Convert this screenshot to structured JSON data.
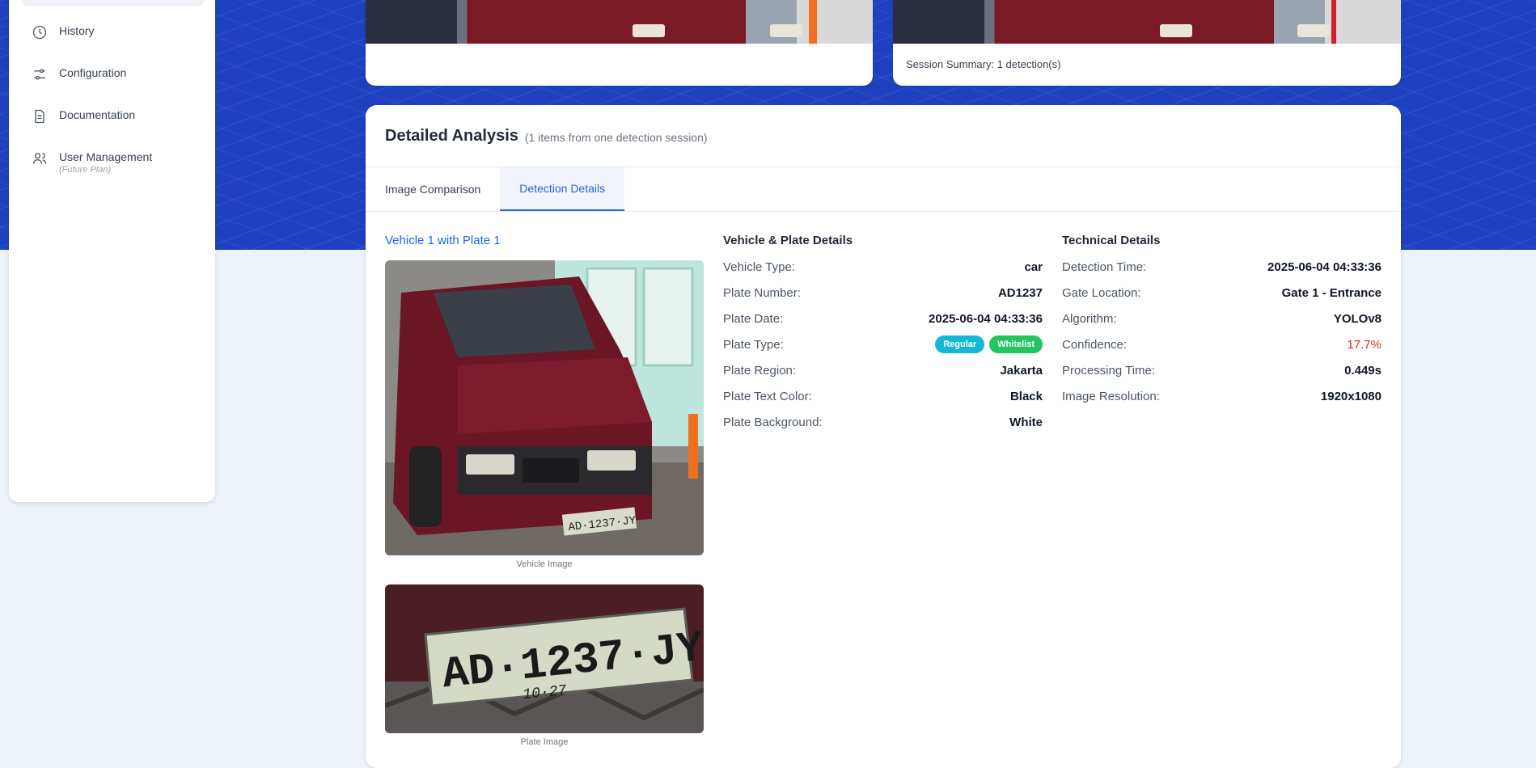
{
  "sidebar": {
    "items": [
      {
        "label": "History",
        "icon": "clock-icon"
      },
      {
        "label": "Configuration",
        "icon": "sliders-icon"
      },
      {
        "label": "Documentation",
        "icon": "document-icon"
      },
      {
        "label": "User Management",
        "icon": "users-icon",
        "sublabel": "(Future Plan)"
      }
    ]
  },
  "top_cards": {
    "right_footer": "Session Summary: 1 detection(s)"
  },
  "analysis": {
    "title": "Detailed Analysis",
    "subtitle": "(1 items from one detection session)",
    "tabs": [
      {
        "label": "Image Comparison",
        "active": false
      },
      {
        "label": "Detection Details",
        "active": true
      }
    ],
    "vehicle_title": "Vehicle 1 with Plate 1",
    "vehicle_caption": "Vehicle Image",
    "plate_caption": "Plate Image",
    "plate_text": "AD·1237·JY",
    "plate_subtext": "10·27",
    "vehicle_plate_text": "AD·1237·JY"
  },
  "vehicle_details": {
    "title": "Vehicle & Plate Details",
    "rows": [
      {
        "label": "Vehicle Type:",
        "value": "car"
      },
      {
        "label": "Plate Number:",
        "value": "AD1237"
      },
      {
        "label": "Plate Date:",
        "value": "2025-06-04 04:33:36"
      },
      {
        "label": "Plate Type:",
        "badges": [
          {
            "text": "Regular",
            "color": "#14b8d4"
          },
          {
            "text": "Whitelist",
            "color": "#22c55e"
          }
        ]
      },
      {
        "label": "Plate Region:",
        "value": "Jakarta"
      },
      {
        "label": "Plate Text Color:",
        "value": "Black"
      },
      {
        "label": "Plate Background:",
        "value": "White"
      }
    ]
  },
  "technical_details": {
    "title": "Technical Details",
    "rows": [
      {
        "label": "Detection Time:",
        "value": "2025-06-04 04:33:36"
      },
      {
        "label": "Gate Location:",
        "value": "Gate 1 - Entrance"
      },
      {
        "label": "Algorithm:",
        "value": "YOLOv8"
      },
      {
        "label": "Confidence:",
        "value": "17.7%",
        "color": "#dc2626"
      },
      {
        "label": "Processing Time:",
        "value": "0.449s"
      },
      {
        "label": "Image Resolution:",
        "value": "1920x1080"
      }
    ]
  }
}
